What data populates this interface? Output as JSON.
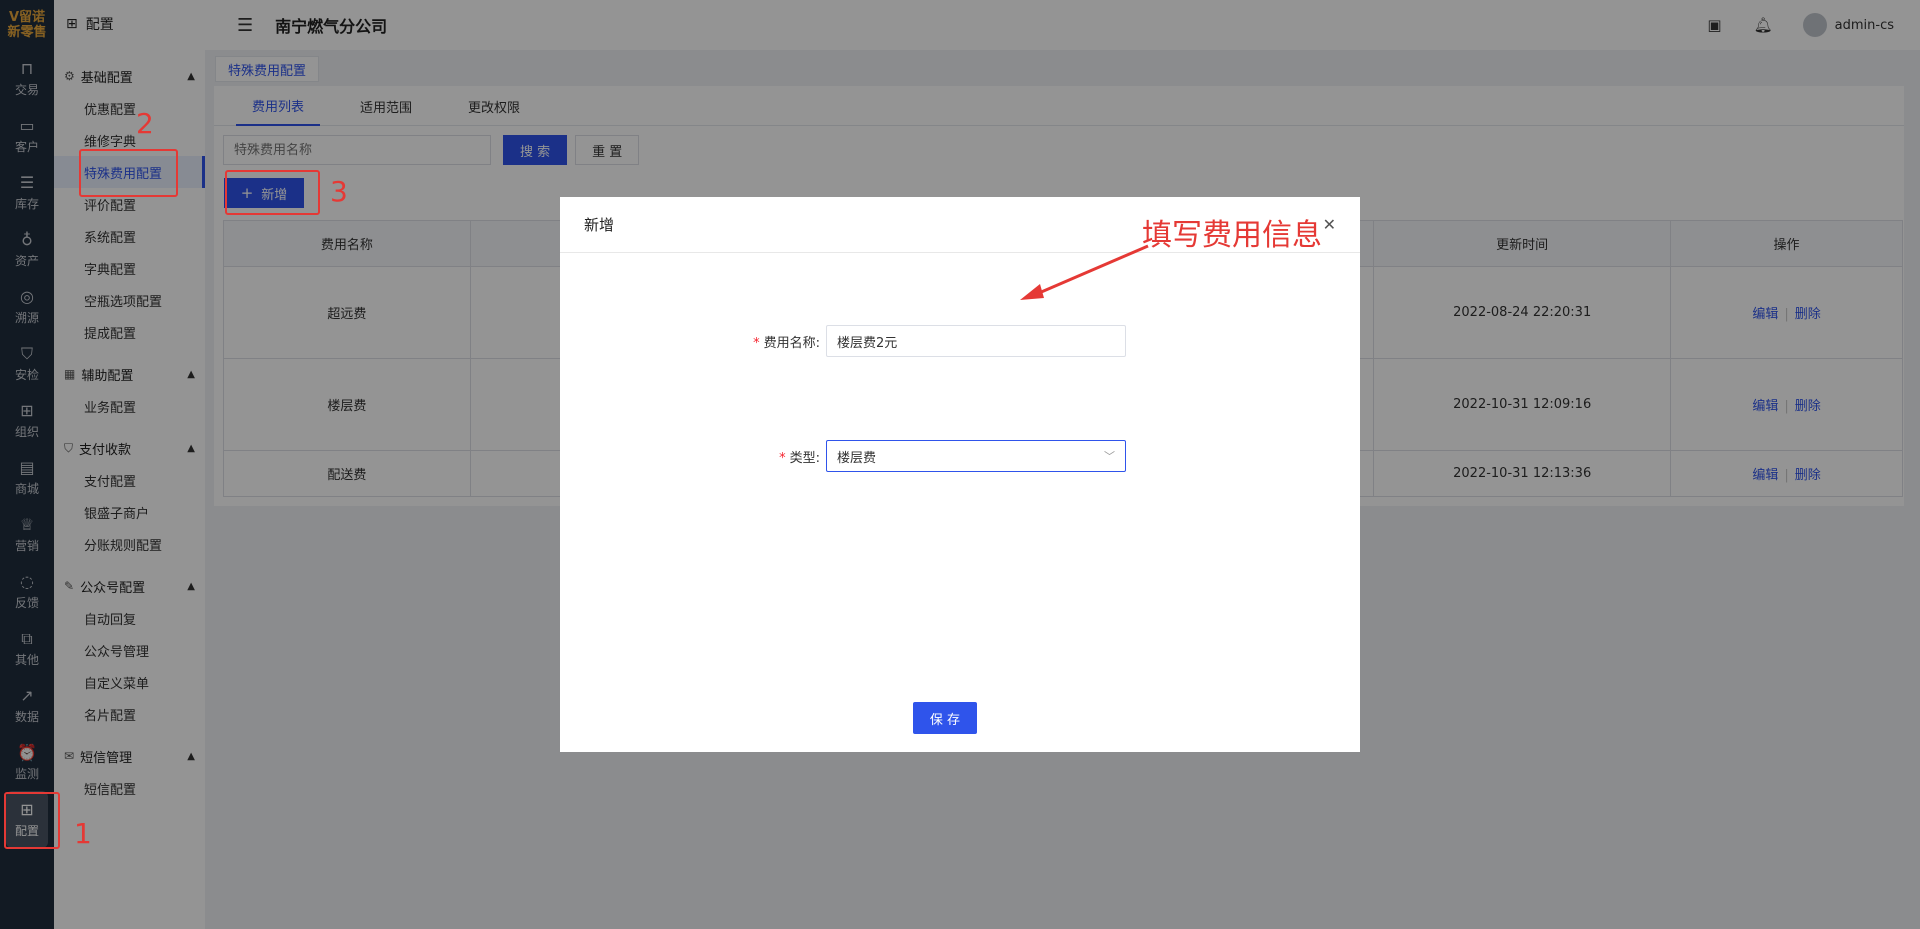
{
  "rail": {
    "logo_top": "ᐯ留诺",
    "logo_bottom": "新零售",
    "items": [
      {
        "label": "交易",
        "icon": "bag-icon"
      },
      {
        "label": "客户",
        "icon": "id-card-icon"
      },
      {
        "label": "库存",
        "icon": "inventory-icon"
      },
      {
        "label": "资产",
        "icon": "bulb-icon"
      },
      {
        "label": "溯源",
        "icon": "compass-icon"
      },
      {
        "label": "安检",
        "icon": "shield-check-icon"
      },
      {
        "label": "组织",
        "icon": "org-icon"
      },
      {
        "label": "商城",
        "icon": "store-icon"
      },
      {
        "label": "营销",
        "icon": "trophy-icon"
      },
      {
        "label": "反馈",
        "icon": "chat-icon"
      },
      {
        "label": "其他",
        "icon": "blocks-icon"
      },
      {
        "label": "数据",
        "icon": "chart-icon"
      },
      {
        "label": "监测",
        "icon": "alarm-icon"
      },
      {
        "label": "配置",
        "icon": "grid-icon"
      }
    ]
  },
  "sidebar": {
    "title": "配置",
    "groups": [
      {
        "label": "基础配置",
        "items": [
          "优惠配置",
          "维修字典",
          "特殊费用配置",
          "评价配置",
          "系统配置",
          "字典配置",
          "空瓶选项配置",
          "提成配置"
        ]
      },
      {
        "label": "辅助配置",
        "items": [
          "业务配置"
        ]
      },
      {
        "label": "支付收款",
        "items": [
          "支付配置",
          "银盛子商户",
          "分账规则配置"
        ]
      },
      {
        "label": "公众号配置",
        "items": [
          "自动回复",
          "公众号管理",
          "自定义菜单",
          "名片配置"
        ]
      },
      {
        "label": "短信管理",
        "items": [
          "短信配置"
        ]
      }
    ]
  },
  "header": {
    "company": "南宁燃气分公司",
    "user": "admin-cs"
  },
  "tag": "特殊费用配置",
  "tabs": [
    "费用列表",
    "适用范围",
    "更改权限"
  ],
  "filter": {
    "placeholder": "特殊费用名称",
    "search_label": "搜 索",
    "reset_label": "重 置",
    "add_label": "新增"
  },
  "table": {
    "headers": [
      "费用名称",
      "",
      "更新时间",
      "操作"
    ],
    "rows": [
      {
        "name": "超远费",
        "time": "2022-08-24 22:20:31"
      },
      {
        "name": "楼层费",
        "time": "2022-10-31 12:09:16"
      },
      {
        "name": "配送费",
        "time": "2022-10-31 12:13:36"
      }
    ],
    "edit_label": "编辑",
    "delete_label": "删除"
  },
  "modal": {
    "title": "新增",
    "close": "✕",
    "name_label": "费用名称:",
    "name_value": "楼层费2元",
    "type_label": "类型:",
    "type_value": "楼层费",
    "save_label": "保 存"
  },
  "annotations": {
    "n1": "1",
    "n2": "2",
    "n3": "3",
    "text": "填写费用信息",
    "color": "#e53935"
  }
}
